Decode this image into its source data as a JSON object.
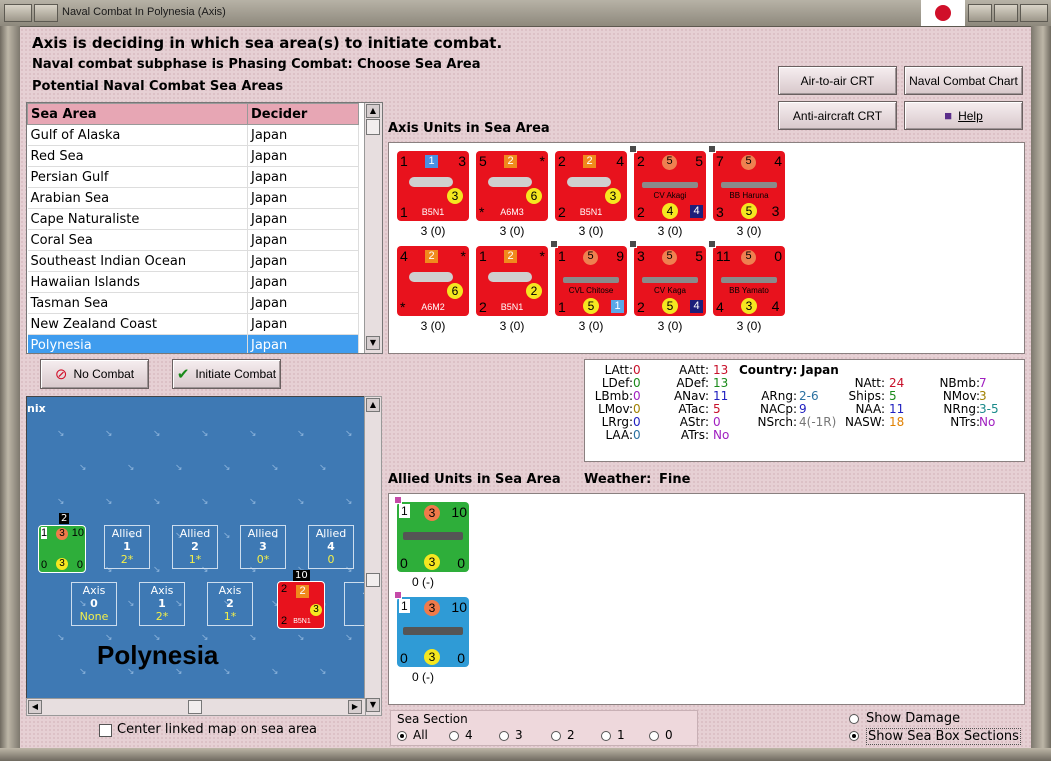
{
  "window": {
    "title": "Naval Combat In Polynesia (Axis)"
  },
  "header": {
    "line1": "Axis is deciding in which sea area(s) to initiate combat.",
    "line2": "Naval combat subphase is Phasing Combat: Choose Sea Area",
    "line3": "Potential Naval Combat Sea Areas"
  },
  "buttons": {
    "air_crt": "Air-to-air CRT",
    "naval_chart": "Naval Combat Chart",
    "aa_crt": "Anti-aircraft CRT",
    "help": "Help",
    "no_combat": "No Combat",
    "initiate": "Initiate Combat"
  },
  "table": {
    "headers": [
      "Sea Area",
      "Decider"
    ],
    "rows": [
      [
        "Gulf of Alaska",
        "Japan"
      ],
      [
        "Red Sea",
        "Japan"
      ],
      [
        "Persian Gulf",
        "Japan"
      ],
      [
        "Arabian Sea",
        "Japan"
      ],
      [
        "Cape Naturaliste",
        "Japan"
      ],
      [
        "Coral Sea",
        "Japan"
      ],
      [
        "Southeast Indian Ocean",
        "Japan"
      ],
      [
        "Hawaiian Islands",
        "Japan"
      ],
      [
        "Tasman Sea",
        "Japan"
      ],
      [
        "New Zealand Coast",
        "Japan"
      ],
      [
        "Polynesia",
        "Japan"
      ]
    ]
  },
  "axis_units": {
    "label": "Axis Units in Sea Area",
    "units": [
      {
        "tl": "1",
        "sq": "1",
        "tr": "3",
        "circ": "3",
        "bl": "1",
        "name": "B5N1",
        "sub": "3 (0)",
        "sqcol": "#4a90e2"
      },
      {
        "tl": "5",
        "sq": "2",
        "tr": "*",
        "circ": "6",
        "bl": "*",
        "name": "A6M3",
        "sub": "3 (0)",
        "sqcol": "#f08a1c"
      },
      {
        "tl": "2",
        "sq": "2",
        "tr": "4",
        "circ": "3",
        "bl": "2",
        "name": "B5N1",
        "sub": "3 (0)",
        "sqcol": "#f08a1c"
      },
      {
        "tl": "2",
        "sq": "5",
        "tr": "5",
        "circ": "4",
        "bl": "2",
        "name": "CV Akagi",
        "sub": "3 (0)",
        "sqcol": "#ef8050",
        "br": "4"
      },
      {
        "tl": "7",
        "sq": "5",
        "tr": "4",
        "circ": "5",
        "bl": "3",
        "name": "BB Haruna",
        "sub": "3 (0)",
        "sqcol": "#ef8050",
        "br": "3"
      },
      {
        "tl": "4",
        "sq": "2",
        "tr": "*",
        "circ": "6",
        "bl": "*",
        "name": "A6M2",
        "sub": "3 (0)",
        "sqcol": "#f08a1c"
      },
      {
        "tl": "1",
        "sq": "2",
        "tr": "*",
        "circ": "2",
        "bl": "2",
        "name": "B5N1",
        "sub": "3 (0)",
        "sqcol": "#f08a1c"
      },
      {
        "tl": "1",
        "sq": "5",
        "tr": "9",
        "circ": "5",
        "bl": "1",
        "name": "CVL Chitose",
        "sub": "3 (0)",
        "sqcol": "#ef8050",
        "br": "1"
      },
      {
        "tl": "3",
        "sq": "5",
        "tr": "5",
        "circ": "5",
        "bl": "2",
        "name": "CV Kaga",
        "sub": "3 (0)",
        "sqcol": "#ef8050",
        "br": "4"
      },
      {
        "tl": "11",
        "sq": "5",
        "tr": "0",
        "circ": "3",
        "bl": "4",
        "name": "BB Yamato",
        "sub": "3 (0)",
        "sqcol": "#ef8050",
        "br": "4"
      }
    ]
  },
  "stats": {
    "LAtt": "0",
    "LDef": "0",
    "LBmb": "0",
    "LMov": "0",
    "LRrg": "0",
    "LAA": "0",
    "AAtt": "13",
    "ADef": "13",
    "ANav": "11",
    "ATac": "5",
    "AStr": "0",
    "ATrs": "No",
    "country_label": "Country:",
    "country": "Japan",
    "ARng": "2-6",
    "NACp": "9",
    "NSrch": "4(-1R)",
    "NAtt": "24",
    "Ships": "5",
    "NAA": "11",
    "NASW": "18",
    "NBmb": "7",
    "NMov": "3",
    "NRng": "3-5",
    "NTrs": "No"
  },
  "allied": {
    "label": "Allied Units in Sea Area",
    "weather_label": "Weather:",
    "weather": "Fine",
    "units": [
      {
        "tl": "1",
        "circ": "3",
        "tr": "10",
        "bl": "0",
        "bc": "3",
        "br": "0",
        "sub": "0 (-)",
        "bg": "#2eae3a"
      },
      {
        "tl": "1",
        "circ": "3",
        "tr": "10",
        "bl": "0",
        "bc": "3",
        "br": "0",
        "sub": "0 (-)",
        "bg": "#2f9bd6"
      }
    ]
  },
  "map": {
    "corner": "nix",
    "name": "Polynesia",
    "allied_boxes": [
      {
        "a": "Allied",
        "b": "1",
        "c": "2*"
      },
      {
        "a": "Allied",
        "b": "2",
        "c": "1*"
      },
      {
        "a": "Allied",
        "b": "3",
        "c": "0*"
      },
      {
        "a": "Allied",
        "b": "4",
        "c": "0"
      }
    ],
    "axis_boxes": [
      {
        "a": "Axis",
        "b": "0",
        "c": "None"
      },
      {
        "a": "Axis",
        "b": "1",
        "c": "2*"
      },
      {
        "a": "Axis",
        "b": "2",
        "c": "1*"
      },
      {
        "a": "A",
        "b": "",
        "c": ""
      }
    ],
    "stack_green": {
      "tl": "1",
      "circ": "3",
      "tr": "10",
      "bl": "0",
      "bc": "3",
      "br": "0",
      "count": "2"
    },
    "stack_red": {
      "count": "10",
      "name": "B5N1",
      "tl": "2",
      "sq": "2",
      "circ": "3",
      "bl": "2"
    }
  },
  "checkbox": {
    "center_label": "Center linked map on sea area"
  },
  "sea_section": {
    "title": "Sea Section",
    "options": [
      "All",
      "4",
      "3",
      "2",
      "1",
      "0"
    ],
    "selected": "All"
  },
  "display_opts": {
    "show_damage": "Show Damage",
    "show_boxes": "Show Sea Box Sections",
    "selected": "Show Sea Box Sections"
  }
}
